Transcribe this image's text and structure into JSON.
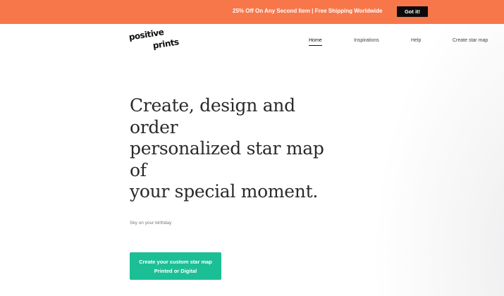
{
  "promo_bar": {
    "text": "25% Off On Any Second Item | Free Shipping Worldwide",
    "button_label": "Got it!",
    "background_color": "#f8774a"
  },
  "header": {
    "logo": {
      "line1": "positive",
      "line2": "prints"
    },
    "nav": [
      {
        "label": "Home",
        "active": true
      },
      {
        "label": "Inspirations",
        "active": false
      },
      {
        "label": "Help",
        "active": false
      },
      {
        "label": "Create star map",
        "active": false
      }
    ]
  },
  "hero": {
    "title_lines": [
      "Create, design and",
      "order",
      "personalized star map",
      "of",
      "your special moment."
    ],
    "subtitle": "Sky on your birthday",
    "cta": {
      "line1": "Create your custom star map",
      "line2": "Printed or Digital",
      "color": "#1cbf95"
    }
  }
}
